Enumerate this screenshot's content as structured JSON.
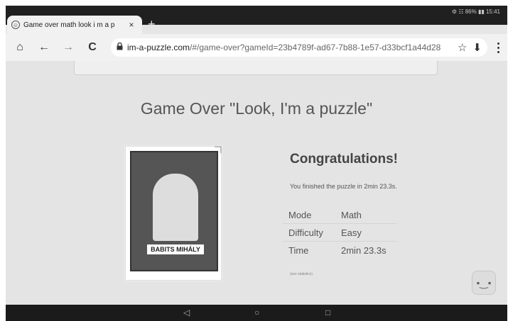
{
  "status": {
    "text": "⚙ ☷ 86% ▮▮ 15:41"
  },
  "tab": {
    "title": "Game over math look i m a p",
    "close": "×"
  },
  "new_tab": "+",
  "toolbar": {
    "home": "⌂",
    "back": "←",
    "forward": "→",
    "reload": "C",
    "lock": "🔒",
    "url_host": "im-a-puzzle.com",
    "url_path": "/#/game-over?gameId=23b4789f-ad67-7b88-1e57-d33bcf1a44d28",
    "star": "☆",
    "download": "⬇"
  },
  "page": {
    "title": "Game Over \"Look, I'm a puzzle\"",
    "congrats": "Congratulations!",
    "finished": "You finished the puzzle in 2min 23.3s.",
    "stats": [
      {
        "label": "Mode",
        "value": "Math"
      },
      {
        "label": "Difficulty",
        "value": "Easy"
      },
      {
        "label": "Time",
        "value": "2min 23.3s"
      }
    ],
    "see_statistics": "(see statistics)",
    "poster_name": "BABITS MIHÁLY"
  },
  "fab": {
    "face": "•‿•"
  },
  "navbar": {
    "back": "◁",
    "home": "○",
    "recents": "□"
  }
}
